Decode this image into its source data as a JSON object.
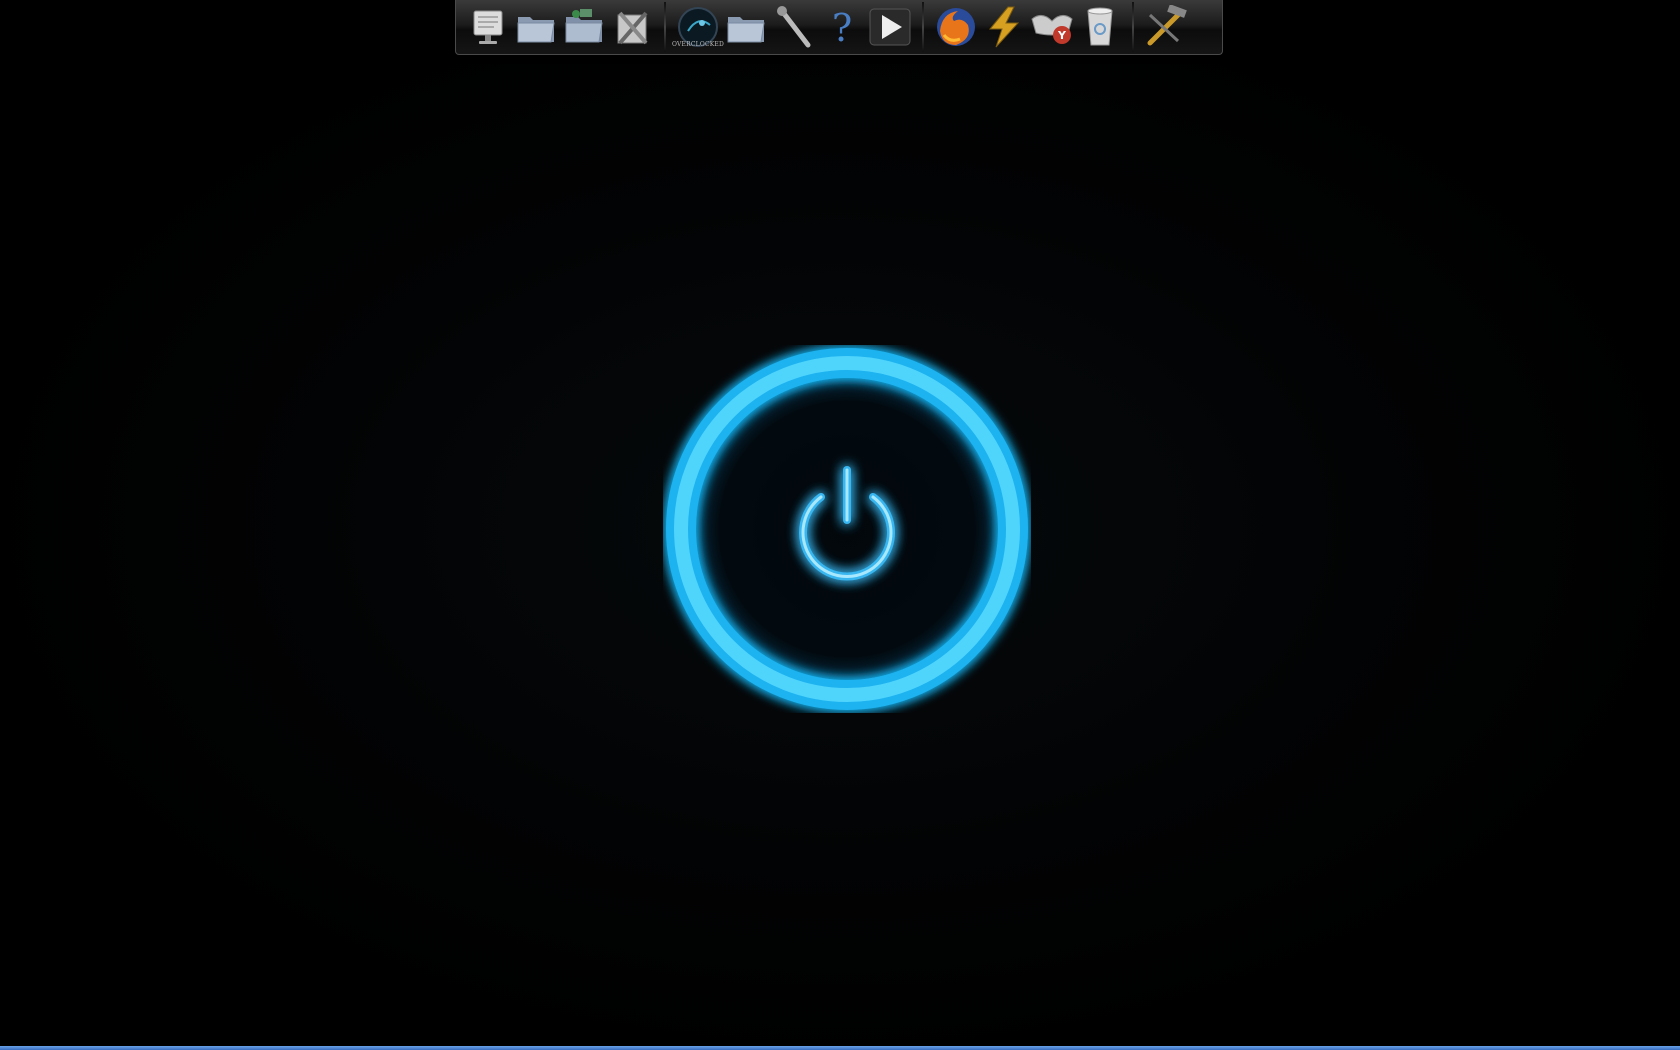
{
  "desktop": {
    "wallpaper_icon": "power-icon",
    "accent_color": "#29c4ff"
  },
  "dock": {
    "group1": [
      {
        "icon": "monitor-icon"
      },
      {
        "icon": "folder-icon"
      },
      {
        "icon": "network-folder-icon"
      },
      {
        "icon": "tools-icon"
      }
    ],
    "group2": [
      {
        "icon": "overclocked-icon",
        "label": "OVERCLOCKED"
      },
      {
        "icon": "folder-icon"
      },
      {
        "icon": "wrench-icon"
      },
      {
        "icon": "help-icon"
      },
      {
        "icon": "play-icon"
      }
    ],
    "group3": [
      {
        "icon": "firefox-icon"
      },
      {
        "icon": "winamp-icon"
      },
      {
        "icon": "yahoo-messenger-icon"
      },
      {
        "icon": "recycle-bin-icon"
      }
    ],
    "group4": [
      {
        "icon": "hammer-wrench-icon"
      }
    ]
  }
}
